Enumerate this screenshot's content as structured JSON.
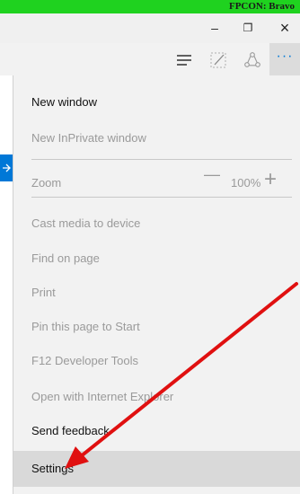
{
  "banner": {
    "text": "FPCON: Bravo"
  },
  "window": {
    "minimize_icon": "–",
    "restore_icon": "❐",
    "close_icon": "×"
  },
  "toolbar": {
    "hub_icon": "hub-icon",
    "note_icon": "web-note-icon",
    "share_icon": "share-icon",
    "more_label": "···"
  },
  "menu": {
    "new_window": "New window",
    "new_inprivate": "New InPrivate window",
    "zoom_label": "Zoom",
    "zoom_minus": "—",
    "zoom_value": "100%",
    "zoom_plus": "+",
    "cast": "Cast media to device",
    "find": "Find on page",
    "print": "Print",
    "pin": "Pin this page to Start",
    "devtools": "F12 Developer Tools",
    "open_ie": "Open with Internet Explorer",
    "feedback": "Send feedback",
    "settings": "Settings"
  },
  "colors": {
    "banner": "#1fd21f",
    "accent": "#0078d7",
    "arrow": "#e01010"
  }
}
